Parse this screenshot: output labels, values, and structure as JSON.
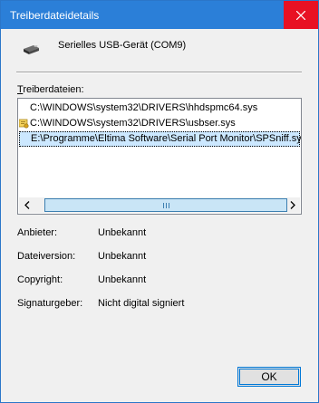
{
  "window": {
    "title": "Treiberdateidetails",
    "close_glyph": "✕"
  },
  "device": {
    "icon": "usb-device-icon",
    "name": "Serielles USB-Gerät (COM9)"
  },
  "files_section": {
    "label_access": "T",
    "label_rest": "reiberdateien:",
    "items": [
      {
        "path": "C:\\WINDOWS\\system32\\DRIVERS\\hhdspmc64.sys",
        "icon": null,
        "selected": false
      },
      {
        "path": "C:\\WINDOWS\\system32\\DRIVERS\\usbser.sys",
        "icon": "signed-certificate-icon",
        "selected": false
      },
      {
        "path": "E:\\Programme\\Eltima Software\\Serial Port Monitor\\SPSniff.sys",
        "icon": null,
        "selected": true
      }
    ]
  },
  "details": {
    "provider_label": "Anbieter:",
    "provider_value": "Unbekannt",
    "version_label": "Dateiversion:",
    "version_value": "Unbekannt",
    "copyright_label": "Copyright:",
    "copyright_value": "Unbekannt",
    "signer_label": "Signaturgeber:",
    "signer_value": "Nicht digital signiert"
  },
  "buttons": {
    "ok": "OK"
  },
  "colors": {
    "titlebar": "#2b7fd8",
    "close": "#e81123",
    "selection": "#cce8ff",
    "scroll_thumb": "#c9e5f6"
  }
}
